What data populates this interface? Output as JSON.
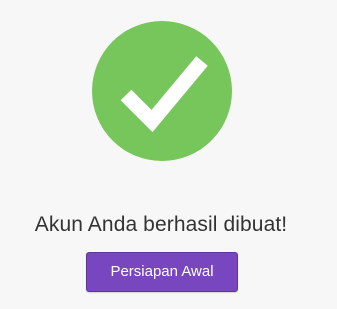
{
  "success": {
    "icon": "checkmark-circle-icon",
    "icon_color": "#77c65b",
    "message": "Akun Anda berhasil dibuat!"
  },
  "actions": {
    "primary_label": "Persiapan Awal",
    "primary_color": "#7847c0"
  }
}
